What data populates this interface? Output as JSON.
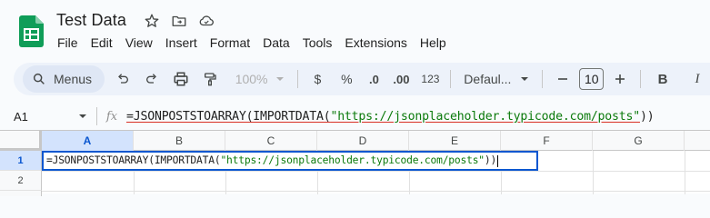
{
  "app": {
    "title": "Test Data",
    "brand_color": "#0f9d58"
  },
  "menubar": {
    "items": [
      "File",
      "Edit",
      "View",
      "Insert",
      "Format",
      "Data",
      "Tools",
      "Extensions",
      "Help"
    ]
  },
  "toolbar": {
    "menus_label": "Menus",
    "zoom_label": "100%",
    "currency_label": "$",
    "percent_label": "%",
    "decrease_decimal_label": ".0",
    "increase_decimal_label": ".00",
    "number_format_label": "123",
    "font_label": "Defaul...",
    "font_size": "10",
    "bold_label": "B",
    "italic_label": "I"
  },
  "formula_bar": {
    "cell_ref": "A1",
    "fx_label": "fx",
    "formula_prefix": "=JSONPOSTSTOARRAY(IMPORTDATA(",
    "formula_string": "\"https://jsonplaceholder.typicode.com/posts\"",
    "formula_suffix": "))"
  },
  "grid": {
    "columns": [
      "A",
      "B",
      "C",
      "D",
      "E",
      "F",
      "G"
    ],
    "rows": [
      "1",
      "2"
    ],
    "active_cell": "A1",
    "active_cell_prefix": "=JSONPOSTSTOARRAY(IMPORTDATA(",
    "active_cell_string": "\"https://jsonplaceholder.typicode.com/posts\"",
    "active_cell_suffix": "))"
  }
}
